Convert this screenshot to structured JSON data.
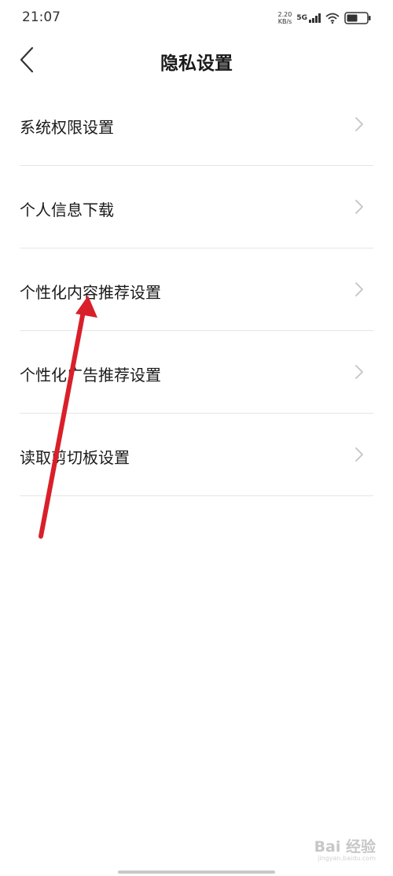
{
  "status_bar": {
    "time": "21:07",
    "net_speed_value": "2.20",
    "net_speed_unit": "KB/s",
    "network_type": "5G",
    "icons": [
      "signal-icon",
      "wifi-icon",
      "battery-icon"
    ]
  },
  "nav": {
    "back_icon": "chevron-left-icon",
    "title": "隐私设置"
  },
  "settings": {
    "items": [
      {
        "label": "系统权限设置"
      },
      {
        "label": "个人信息下载"
      },
      {
        "label": "个性化内容推荐设置"
      },
      {
        "label": "个性化广告推荐设置"
      },
      {
        "label": "读取剪切板设置"
      }
    ]
  },
  "annotation": {
    "color": "#d9202a",
    "points_to": "个性化内容推荐设置"
  },
  "watermark": {
    "brand": "Bai 经验",
    "url": "jingyan.baidu.com"
  },
  "colors": {
    "divider": "#e6e6e6",
    "chevron": "#c4c4c4",
    "text": "#1a1a1a"
  }
}
